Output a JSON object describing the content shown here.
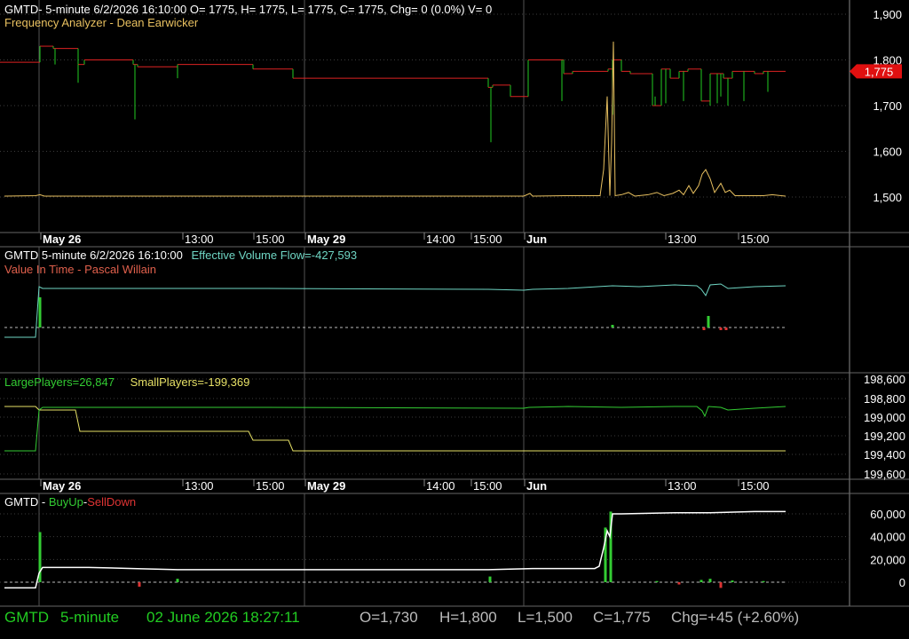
{
  "header": {
    "pane1_line1": "GMTD- 5-minute 6/2/2026 16:10:00 O= 1775, H= 1775, L= 1775, C= 1775, Chg= 0 (0.0%) V= 0",
    "pane1_line2": "Frequency Analyzer - Dean Earwicker",
    "pane2_line1_a": "GMTD 5-minute  6/2/2026 16:10:00",
    "pane2_line1_b": "Effective Volume Flow=-427,593",
    "pane2_line2": "Value In Time - Pascal Willain",
    "pane3_large": "LargePlayers=26,847",
    "pane3_small": "SmallPlayers=-199,369",
    "pane4_prefix": "GMTD - ",
    "pane4_buy": "BuyUp",
    "pane4_dash": "-",
    "pane4_sell": "SellDown"
  },
  "status_bar": {
    "symbol": "GMTD",
    "interval": "5-minute",
    "datetime": "02 June 2026 18:27:11",
    "open": "O=1,730",
    "high": "H=1,800",
    "low": "L=1,500",
    "close": "C=1,775",
    "change": "Chg=+45 (+2.60%)"
  },
  "colors": {
    "background": "#000000",
    "grid": "#3c3c3c",
    "price_up": "#22cc22",
    "price_down": "#dd2222",
    "frequency_line": "#e8c060",
    "volume_flow": "#6fd6c4",
    "large_players": "#33cc33",
    "small_players": "#e6e066",
    "buyup_bar": "#33cc33",
    "selldown_bar": "#dd3333",
    "cumulative_line": "#ffffff",
    "status_green": "#22cc22",
    "status_gray": "#bbbbbb",
    "price_tag": "#e01010"
  },
  "chart_data": [
    {
      "type": "line",
      "name": "price-pane",
      "x_tick_labels": [
        "May 26",
        "13:00",
        "15:00",
        "May 29",
        "14:00",
        "15:00",
        "Jun",
        "13:00",
        "15:00"
      ],
      "y_ticks": [
        1500,
        1600,
        1700,
        1800,
        1900
      ],
      "y_tick_labels": [
        "1,500",
        "1,600",
        "1,700",
        "1,800",
        "1,900"
      ],
      "ylim": [
        1425,
        1925
      ],
      "last_price_label": "1,775",
      "last_price": 1775,
      "price_steps": [
        [
          0,
          1795
        ],
        [
          45,
          1830
        ],
        [
          60,
          1825
        ],
        [
          88,
          1790
        ],
        [
          95,
          1800
        ],
        [
          150,
          1790
        ],
        [
          155,
          1785
        ],
        [
          200,
          1790
        ],
        [
          285,
          1780
        ],
        [
          330,
          1760
        ],
        [
          550,
          1740
        ],
        [
          555,
          1745
        ],
        [
          575,
          1720
        ],
        [
          595,
          1800
        ],
        [
          635,
          1770
        ],
        [
          645,
          1775
        ],
        [
          685,
          1780
        ],
        [
          690,
          1800
        ],
        [
          700,
          1775
        ],
        [
          710,
          1770
        ],
        [
          735,
          1700
        ],
        [
          745,
          1780
        ],
        [
          755,
          1760
        ],
        [
          765,
          1775
        ],
        [
          775,
          1780
        ],
        [
          790,
          1710
        ],
        [
          800,
          1770
        ],
        [
          815,
          1760
        ],
        [
          825,
          1775
        ],
        [
          850,
          1770
        ],
        [
          860,
          1775
        ],
        [
          885,
          1775
        ]
      ],
      "down_spikes": [
        [
          45,
          1800
        ],
        [
          62,
          1790
        ],
        [
          88,
          1750
        ],
        [
          152,
          1670
        ],
        [
          200,
          1760
        ],
        [
          553,
          1620
        ],
        [
          592,
          1720
        ],
        [
          633,
          1710
        ],
        [
          690,
          1680
        ],
        [
          738,
          1720
        ],
        [
          750,
          1705
        ],
        [
          770,
          1710
        ],
        [
          800,
          1700
        ],
        [
          808,
          1705
        ],
        [
          812,
          1720
        ],
        [
          820,
          1700
        ],
        [
          838,
          1710
        ],
        [
          865,
          1730
        ]
      ],
      "frequency_line": [
        [
          5,
          1502
        ],
        [
          40,
          1503
        ],
        [
          45,
          1505
        ],
        [
          50,
          1502
        ],
        [
          300,
          1502
        ],
        [
          560,
          1502
        ],
        [
          590,
          1502
        ],
        [
          597,
          1508
        ],
        [
          600,
          1502
        ],
        [
          640,
          1503
        ],
        [
          676,
          1503
        ],
        [
          680,
          1560
        ],
        [
          684,
          1720
        ],
        [
          687,
          1503
        ],
        [
          689,
          1620
        ],
        [
          691,
          1840
        ],
        [
          693,
          1503
        ],
        [
          700,
          1505
        ],
        [
          708,
          1510
        ],
        [
          715,
          1502
        ],
        [
          730,
          1505
        ],
        [
          740,
          1510
        ],
        [
          748,
          1503
        ],
        [
          758,
          1508
        ],
        [
          765,
          1515
        ],
        [
          770,
          1505
        ],
        [
          776,
          1525
        ],
        [
          781,
          1508
        ],
        [
          787,
          1525
        ],
        [
          791,
          1550
        ],
        [
          795,
          1560
        ],
        [
          800,
          1540
        ],
        [
          805,
          1510
        ],
        [
          812,
          1530
        ],
        [
          817,
          1510
        ],
        [
          822,
          1515
        ],
        [
          828,
          1503
        ],
        [
          860,
          1503
        ],
        [
          870,
          1505
        ],
        [
          880,
          1503
        ],
        [
          885,
          1502
        ]
      ]
    },
    {
      "type": "line",
      "name": "value-in-time-pane",
      "series": [
        {
          "name": "Effective Volume Flow",
          "values": [
            [
              5,
              380
            ],
            [
              40,
              380
            ],
            [
              44,
              323
            ],
            [
              48,
              325
            ],
            [
              300,
              325
            ],
            [
              550,
              326
            ],
            [
              590,
              327
            ],
            [
              600,
              326
            ],
            [
              640,
              325
            ],
            [
              690,
              322
            ],
            [
              720,
              323
            ],
            [
              760,
              321
            ],
            [
              785,
              322
            ],
            [
              790,
              326
            ],
            [
              795,
              333
            ],
            [
              800,
              321
            ],
            [
              812,
              320
            ],
            [
              820,
              325
            ],
            [
              850,
              323
            ],
            [
              885,
              322
            ]
          ]
        }
      ],
      "zero_line": 369,
      "bars": [
        [
          45,
          335,
          "up"
        ],
        [
          690,
          366,
          "up"
        ],
        [
          793,
          372,
          "down"
        ],
        [
          798,
          356,
          "up"
        ],
        [
          812,
          372,
          "down"
        ],
        [
          818,
          372,
          "down"
        ]
      ]
    },
    {
      "type": "line",
      "name": "players-pane",
      "y_ticks": [
        198600,
        198800,
        199000,
        199200,
        199400,
        199600
      ],
      "y_tick_labels": [
        "198,600",
        "198,800",
        "199,000",
        "199,200",
        "199,400",
        "199,600"
      ],
      "series": [
        {
          "name": "LargePlayers",
          "values": [
            [
              5,
              508
            ],
            [
              40,
              508
            ],
            [
              44,
              462
            ],
            [
              48,
              459
            ],
            [
              300,
              459
            ],
            [
              590,
              460
            ],
            [
              596,
              459
            ],
            [
              640,
              458
            ],
            [
              700,
              459
            ],
            [
              760,
              458
            ],
            [
              785,
              458
            ],
            [
              791,
              463
            ],
            [
              794,
              469
            ],
            [
              798,
              458
            ],
            [
              812,
              459
            ],
            [
              820,
              462
            ],
            [
              850,
              460
            ],
            [
              885,
              458
            ]
          ]
        },
        {
          "name": "SmallPlayers",
          "values": [
            [
              5,
              458
            ],
            [
              40,
              458
            ],
            [
              44,
              462
            ],
            [
              85,
              462
            ],
            [
              90,
              486
            ],
            [
              280,
              486
            ],
            [
              285,
              496
            ],
            [
              325,
              496
            ],
            [
              330,
              508
            ],
            [
              885,
              508
            ]
          ]
        }
      ],
      "x_tick_labels": [
        "May 26",
        "13:00",
        "15:00",
        "May 29",
        "14:00",
        "15:00",
        "Jun",
        "13:00",
        "15:00"
      ]
    },
    {
      "type": "bar",
      "name": "buyup-selldown-pane",
      "y_ticks": [
        0,
        20000,
        40000,
        60000
      ],
      "y_tick_labels": [
        "0",
        "20,000",
        "40,000",
        "60,000"
      ],
      "ylim": [
        -5000,
        70000
      ],
      "cumulative": [
        [
          5,
          -5000
        ],
        [
          40,
          -5000
        ],
        [
          44,
          8000
        ],
        [
          48,
          13000
        ],
        [
          100,
          13000
        ],
        [
          150,
          12000
        ],
        [
          200,
          11000
        ],
        [
          280,
          11000
        ],
        [
          550,
          11000
        ],
        [
          600,
          12000
        ],
        [
          670,
          12000
        ],
        [
          675,
          14000
        ],
        [
          680,
          30000
        ],
        [
          684,
          45000
        ],
        [
          687,
          40000
        ],
        [
          690,
          60000
        ],
        [
          700,
          60000
        ],
        [
          760,
          61000
        ],
        [
          800,
          61000
        ],
        [
          850,
          62000
        ],
        [
          885,
          62000
        ]
      ],
      "buy_bars": [
        [
          45,
          44000
        ],
        [
          200,
          3000
        ],
        [
          552,
          5000
        ],
        [
          682,
          48000
        ],
        [
          688,
          62000
        ],
        [
          740,
          1000
        ],
        [
          790,
          2000
        ],
        [
          800,
          3000
        ],
        [
          825,
          1500
        ],
        [
          860,
          1000
        ]
      ],
      "sell_bars": [
        [
          157,
          -4000
        ],
        [
          765,
          -2000
        ],
        [
          812,
          -5000
        ]
      ]
    }
  ]
}
